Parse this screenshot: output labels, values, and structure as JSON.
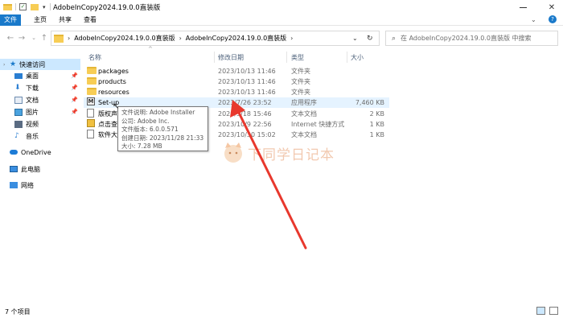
{
  "window": {
    "title": "AdobeInCopy2024.19.0.0直装版",
    "minimize_icon": "minimize-icon",
    "close_icon": "close-icon"
  },
  "ribbon": {
    "tabs": [
      "文件",
      "主页",
      "共享",
      "查看"
    ]
  },
  "nav": {
    "path": [
      "AdobeInCopy2024.19.0.0直装版",
      "AdobeInCopy2024.19.0.0直装版"
    ],
    "search_placeholder": "在 AdobeInCopy2024.19.0.0直装版 中搜索"
  },
  "sidebar": {
    "items": [
      {
        "label": "快速访问",
        "icon": "star-icon",
        "selected": true
      },
      {
        "label": "桌面",
        "icon": "desktop-icon"
      },
      {
        "label": "下载",
        "icon": "download-icon"
      },
      {
        "label": "文档",
        "icon": "document-icon"
      },
      {
        "label": "图片",
        "icon": "picture-icon"
      },
      {
        "label": "视频",
        "icon": "video-icon"
      },
      {
        "label": "音乐",
        "icon": "music-icon"
      },
      {
        "label": "OneDrive",
        "icon": "cloud-icon"
      },
      {
        "label": "此电脑",
        "icon": "computer-icon"
      },
      {
        "label": "网络",
        "icon": "network-icon"
      }
    ]
  },
  "columns": {
    "name": "名称",
    "date": "修改日期",
    "type": "类型",
    "size": "大小"
  },
  "files": [
    {
      "name": "packages",
      "date": "2023/10/13 11:46",
      "type": "文件夹",
      "size": ""
    },
    {
      "name": "products",
      "date": "2023/10/13 11:46",
      "type": "文件夹",
      "size": ""
    },
    {
      "name": "resources",
      "date": "2023/10/13 11:46",
      "type": "文件夹",
      "size": ""
    },
    {
      "name": "Set-up",
      "date": "2023/7/26 23:52",
      "type": "应用程序",
      "size": "7,460 KB"
    },
    {
      "name": "版权声明",
      "date": "2023/5/18 15:46",
      "type": "文本文档",
      "size": "2 KB"
    },
    {
      "name": "点击查看",
      "date": "2023/10/9 22:56",
      "type": "Internet 快捷方式",
      "size": "1 KB"
    },
    {
      "name": "软件大全",
      "date": "2023/10/30 15:02",
      "type": "文本文档",
      "size": "1 KB"
    }
  ],
  "tooltip": {
    "lines": [
      "文件说明: Adobe Installer",
      "公司: Adobe Inc.",
      "文件版本: 6.0.0.571",
      "创建日期: 2023/11/28 21:33",
      "大小: 7.28 MB"
    ]
  },
  "status": {
    "count": "7 个项目"
  },
  "watermark": {
    "text": "下同学日记本"
  },
  "colors": {
    "accent": "#1979ca",
    "selected_bg": "#cce8ff",
    "arrow": "#e8382d"
  }
}
